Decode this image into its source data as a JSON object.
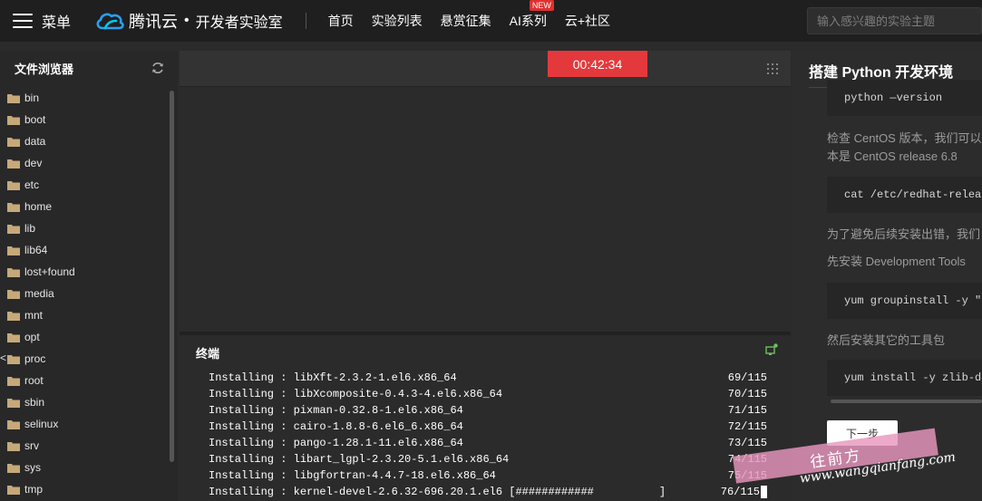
{
  "topbar": {
    "menu_label": "菜单",
    "brand_name": "腾讯云",
    "brand_dot": "•",
    "brand_sub": "开发者实验室",
    "nav": [
      {
        "label": "首页"
      },
      {
        "label": "实验列表"
      },
      {
        "label": "悬赏征集"
      },
      {
        "label": "AI系列",
        "badge": "NEW"
      },
      {
        "label": "云+社区"
      }
    ],
    "search_placeholder": "输入感兴趣的实验主题"
  },
  "sidebar": {
    "title": "文件浏览器",
    "edge_marker": "<",
    "items": [
      "bin",
      "boot",
      "data",
      "dev",
      "etc",
      "home",
      "lib",
      "lib64",
      "lost+found",
      "media",
      "mnt",
      "opt",
      "proc",
      "root",
      "sbin",
      "selinux",
      "srv",
      "sys",
      "tmp"
    ]
  },
  "main": {
    "timer": "00:42:34"
  },
  "terminal": {
    "title": "终端",
    "lines": [
      {
        "text": "Installing : libXft-2.3.2-1.el6.x86_64",
        "count": "69/115"
      },
      {
        "text": "Installing : libXcomposite-0.4.3-4.el6.x86_64",
        "count": "70/115"
      },
      {
        "text": "Installing : pixman-0.32.8-1.el6.x86_64",
        "count": "71/115"
      },
      {
        "text": "Installing : cairo-1.8.8-6.el6_6.x86_64",
        "count": "72/115"
      },
      {
        "text": "Installing : pango-1.28.1-11.el6.x86_64",
        "count": "73/115"
      },
      {
        "text": "Installing : libart_lgpl-2.3.20-5.1.el6.x86_64",
        "count": "74/115"
      },
      {
        "text": "Installing : libgfortran-4.4.7-18.el6.x86_64",
        "count": "75/115"
      },
      {
        "text": "Installing : kernel-devel-2.6.32-696.20.1.el6 [############          ]",
        "count": "76/115"
      }
    ]
  },
  "guide": {
    "title": "搭建 Python 开发环境",
    "code1": "python —version",
    "text1a": "检查 CentOS 版本，我们可以",
    "text1b": "本是 CentOS release 6.8",
    "code2": "cat /etc/redhat-release",
    "text2": "为了避免后续安装出错，我们",
    "text3": "先安装 Development Tools",
    "code3": "yum groupinstall -y \"Development Tools\"",
    "text4": "然后安装其它的工具包",
    "code4": "yum install -y zlib-devel",
    "next_button": "下一步"
  },
  "watermark": {
    "cn": "往前方",
    "url": "www.wangqianfang.com"
  },
  "colors": {
    "timer_bg": "#e4393c",
    "badge_bg": "#e0312f",
    "brand_blue": "#2a9ef0",
    "folder": "#c6a97a"
  }
}
